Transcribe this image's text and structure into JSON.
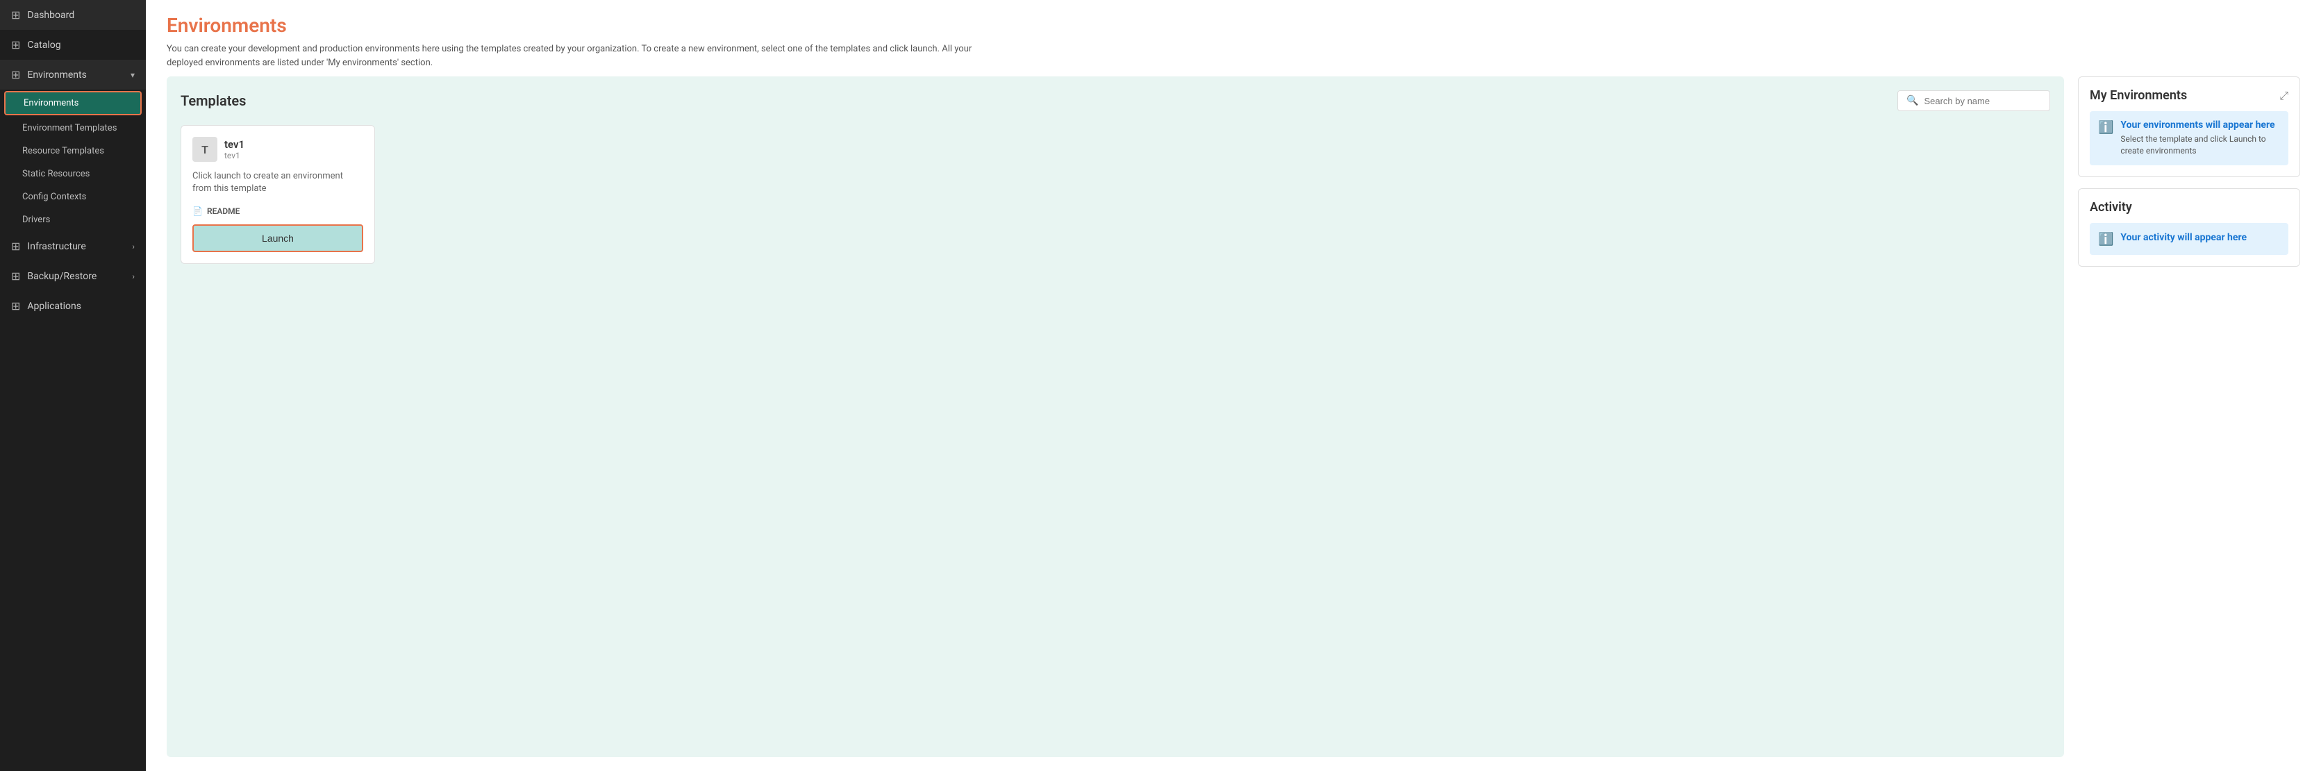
{
  "sidebar": {
    "items": [
      {
        "id": "dashboard",
        "label": "Dashboard",
        "icon": "⊞",
        "hasChildren": false
      },
      {
        "id": "catalog",
        "label": "Catalog",
        "icon": "⊞",
        "hasChildren": false
      },
      {
        "id": "environments",
        "label": "Environments",
        "icon": "⊞",
        "hasChildren": true,
        "children": [
          {
            "id": "environments-sub",
            "label": "Environments",
            "active": true
          },
          {
            "id": "environment-templates",
            "label": "Environment Templates"
          },
          {
            "id": "resource-templates",
            "label": "Resource Templates"
          },
          {
            "id": "static-resources",
            "label": "Static Resources"
          },
          {
            "id": "config-contexts",
            "label": "Config Contexts"
          },
          {
            "id": "drivers",
            "label": "Drivers"
          }
        ]
      },
      {
        "id": "infrastructure",
        "label": "Infrastructure",
        "icon": "⊞",
        "hasChevron": true
      },
      {
        "id": "backup-restore",
        "label": "Backup/Restore",
        "icon": "⊞",
        "hasChevron": true
      },
      {
        "id": "applications",
        "label": "Applications",
        "icon": "⊞"
      }
    ]
  },
  "page": {
    "title": "Environments",
    "description": "You can create your development and production environments here using the templates created by your organization. To create a new environment, select one of the templates and click launch. All your deployed environments are listed under 'My environments' section."
  },
  "templates_panel": {
    "title": "Templates",
    "search_placeholder": "Search by name",
    "cards": [
      {
        "avatar_letter": "T",
        "name": "tev1",
        "sub": "tev1",
        "description": "Click launch to create an environment from this template",
        "readme_label": "README",
        "launch_label": "Launch"
      }
    ]
  },
  "my_environments": {
    "title": "My Environments",
    "expand_icon": "⤢",
    "empty_title": "Your environments will appear here",
    "empty_subtitle": "Select the template and click Launch to create environments"
  },
  "activity": {
    "title": "Activity",
    "empty_title": "Your activity will appear here"
  }
}
